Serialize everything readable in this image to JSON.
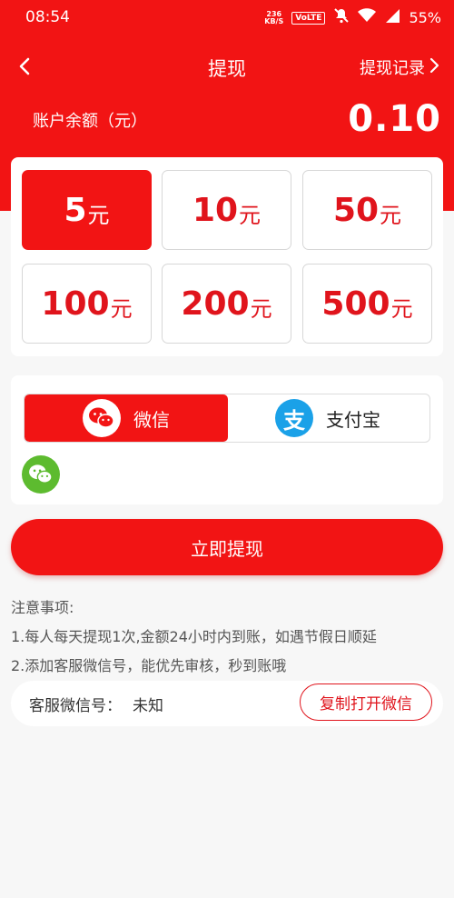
{
  "status_bar": {
    "time": "08:54",
    "speed": "236",
    "speed_unit": "KB/S",
    "volte": "VoLTE",
    "battery": "55%"
  },
  "nav": {
    "title": "提现",
    "record_link": "提现记录"
  },
  "balance": {
    "label": "账户余额（元）",
    "value": "0.10"
  },
  "amounts": [
    {
      "num": "5",
      "unit": "元",
      "selected": true
    },
    {
      "num": "10",
      "unit": "元",
      "selected": false
    },
    {
      "num": "50",
      "unit": "元",
      "selected": false
    },
    {
      "num": "100",
      "unit": "元",
      "selected": false
    },
    {
      "num": "200",
      "unit": "元",
      "selected": false
    },
    {
      "num": "500",
      "unit": "元",
      "selected": false
    }
  ],
  "payment": {
    "wechat_label": "微信",
    "alipay_label": "支付宝",
    "alipay_glyph": "支",
    "selected": "wechat"
  },
  "submit_label": "立即提现",
  "notes": {
    "title": "注意事项:",
    "items": [
      "1.每人每天提现1次,金额24小时内到账，如遇节假日顺延",
      "2.添加客服微信号，能优先审核，秒到账哦"
    ]
  },
  "service": {
    "label": "客服微信号：",
    "value": "未知",
    "copy_button": "复制打开微信"
  },
  "colors": {
    "primary_red": "#f21414",
    "accent_red": "#e0141c",
    "wechat_green": "#5dbb2f",
    "alipay_blue": "#1aa1e8"
  }
}
